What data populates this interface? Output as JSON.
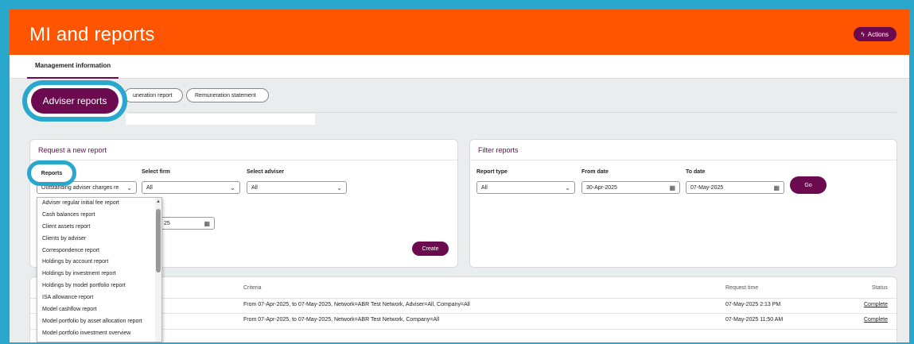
{
  "header": {
    "title": "MI and reports",
    "actions_label": "Actions"
  },
  "tabs": [
    {
      "label": "Management information"
    }
  ],
  "report_pills": {
    "adviser_reports": "Adviser reports",
    "remuneration_report": "uneration report",
    "remuneration_statement": "Remuneration statement"
  },
  "request_panel": {
    "title": "Request a new report",
    "reports_label": "Reports",
    "reports_value": "Outstanding adviser charges re",
    "firm_label": "Select firm",
    "firm_value": "All",
    "adviser_label": "Select adviser",
    "adviser_value": "All",
    "date_partial": "25",
    "create_label": "Create"
  },
  "filter_panel": {
    "title": "Filter reports",
    "report_type_label": "Report type",
    "report_type_value": "All",
    "from_label": "From date",
    "from_value": "30-Apr-2025",
    "to_label": "To date",
    "to_value": "07-May-2025",
    "go_label": "Go"
  },
  "dropdown_items": [
    "Adviser regular initial fee report",
    "Cash balances report",
    "Client assets report",
    "Clients by adviser",
    "Correspondence report",
    "Holdings by account report",
    "Holdings by investment report",
    "Holdings by model portfolio report",
    "ISA allowance report",
    "Model cashflow report",
    "Model portfolio by asset allocation report",
    "Model portfolio investment overview"
  ],
  "table": {
    "headers": {
      "criteria": "Criteria",
      "request_time": "Request time",
      "status": "Status"
    },
    "rows": [
      {
        "criteria": "From 07-Apr-2025, to 07-May-2025, Network=ABR Test Network, Adviser=All, Company=All",
        "request_time": "07-May-2025 2:13 PM",
        "status": "Complete"
      },
      {
        "criteria": "From 07-Apr-2025, to 07-May-2025, Network=ABR Test Network, Company=All",
        "request_time": "07-May-2025 11:50 AM",
        "status": "Complete"
      }
    ]
  },
  "colors": {
    "brand_orange": "#ff5500",
    "plum": "#6b0a4e",
    "highlight_blue": "#2aa7cc"
  }
}
